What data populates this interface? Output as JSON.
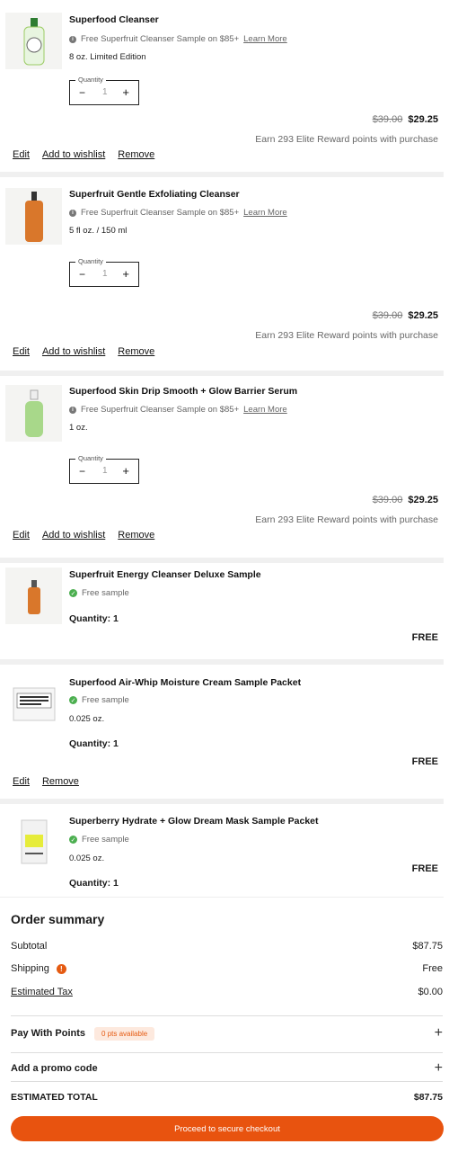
{
  "items": [
    {
      "name": "Superfood Cleanser",
      "note": "Free Superfruit Cleanser Sample on $85+",
      "learn_more": "Learn More",
      "size": "8 oz. Limited Edition",
      "qty_legend": "Quantity",
      "qty_value": "1",
      "old_price": "$39.00",
      "new_price": "$29.25",
      "earn": "Earn 293 Elite Reward points with purchase",
      "edit": "Edit",
      "wishlist": "Add to wishlist",
      "remove": "Remove"
    },
    {
      "name": "Superfruit Gentle Exfoliating Cleanser",
      "note": "Free Superfruit Cleanser Sample on $85+",
      "learn_more": "Learn More",
      "size": "5 fl oz. / 150 ml",
      "qty_legend": "Quantity",
      "qty_value": "1",
      "old_price": "$39.00",
      "new_price": "$29.25",
      "earn": "Earn 293 Elite Reward points with purchase",
      "edit": "Edit",
      "wishlist": "Add to wishlist",
      "remove": "Remove"
    },
    {
      "name": "Superfood Skin Drip Smooth + Glow Barrier Serum",
      "note": "Free Superfruit Cleanser Sample on $85+",
      "learn_more": "Learn More",
      "size": "1 oz.",
      "qty_legend": "Quantity",
      "qty_value": "1",
      "old_price": "$39.00",
      "new_price": "$29.25",
      "earn": "Earn 293 Elite Reward points with purchase",
      "edit": "Edit",
      "wishlist": "Add to wishlist",
      "remove": "Remove"
    }
  ],
  "samples": [
    {
      "name": "Superfruit Energy Cleanser Deluxe Sample",
      "note": "Free sample",
      "size": "",
      "qty": "Quantity: 1",
      "price": "FREE"
    },
    {
      "name": "Superfood Air-Whip Moisture Cream Sample Packet",
      "note": "Free sample",
      "size": "0.025 oz.",
      "qty": "Quantity: 1",
      "price": "FREE",
      "edit": "Edit",
      "remove": "Remove"
    },
    {
      "name": "Superberry Hydrate + Glow Dream Mask Sample Packet",
      "note": "Free sample",
      "size": "0.025 oz.",
      "qty": "Quantity: 1",
      "price": "FREE"
    }
  ],
  "summary": {
    "title": "Order summary",
    "subtotal_label": "Subtotal",
    "subtotal_value": "$87.75",
    "shipping_label": "Shipping",
    "shipping_value": "Free",
    "tax_label": "Estimated Tax",
    "tax_value": "$0.00",
    "points_label": "Pay With Points",
    "points_badge": "0 pts available",
    "promo_label": "Add a promo code",
    "total_label": "ESTIMATED TOTAL",
    "total_value": "$87.75",
    "checkout_label": "Proceed to secure checkout"
  },
  "colors": {
    "accent": "#e8530f",
    "check": "#4caf50",
    "divider": "#f0f0f0"
  }
}
